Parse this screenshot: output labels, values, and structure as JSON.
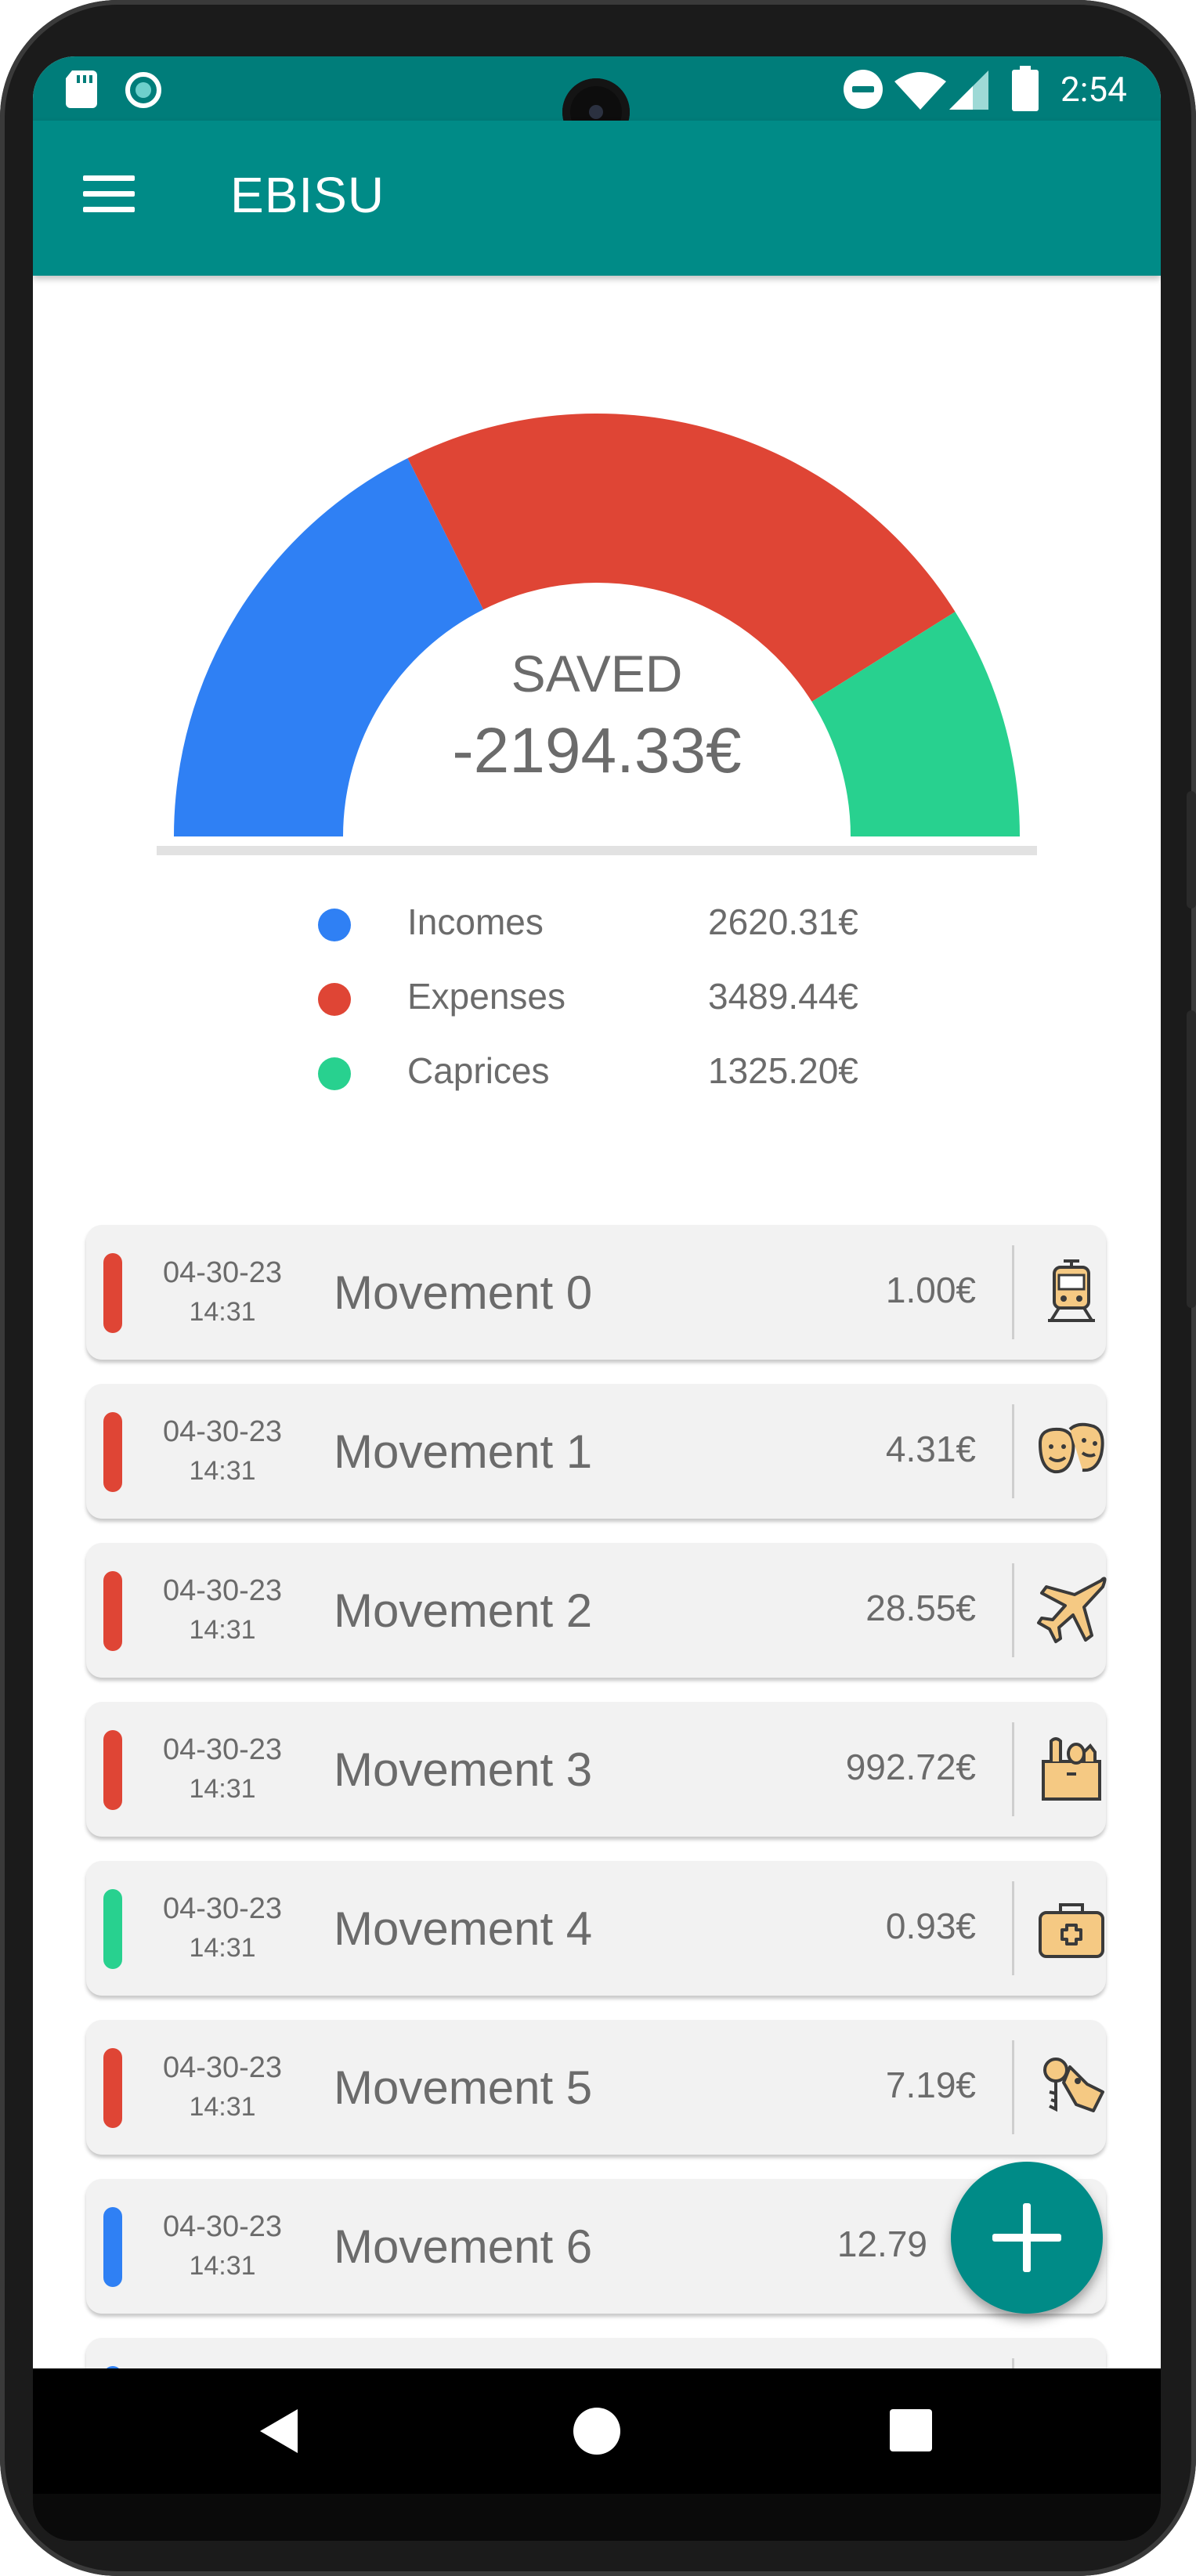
{
  "status_bar": {
    "time": "2:54"
  },
  "app_bar": {
    "title": "EBISU"
  },
  "gauge": {
    "label": "SAVED",
    "value": "-2194.33€"
  },
  "chart_data": {
    "type": "pie",
    "categories": [
      "Incomes",
      "Expenses",
      "Caprices"
    ],
    "values": [
      2620.31,
      3489.44,
      1325.2
    ],
    "colors": [
      "#2f80f4",
      "#df4535",
      "#28d18f"
    ]
  },
  "legend": [
    {
      "name": "Incomes",
      "value": "2620.31€",
      "color": "#2f80f4"
    },
    {
      "name": "Expenses",
      "value": "3489.44€",
      "color": "#df4535"
    },
    {
      "name": "Caprices",
      "value": "1325.20€",
      "color": "#28d18f"
    }
  ],
  "movements": [
    {
      "date": "04-30-23",
      "time": "14:31",
      "name": "Movement 0",
      "amount": "1.00€",
      "type_color": "#df4535",
      "icon": "train-icon"
    },
    {
      "date": "04-30-23",
      "time": "14:31",
      "name": "Movement 1",
      "amount": "4.31€",
      "type_color": "#df4535",
      "icon": "theater-masks-icon"
    },
    {
      "date": "04-30-23",
      "time": "14:31",
      "name": "Movement 2",
      "amount": "28.55€",
      "type_color": "#df4535",
      "icon": "airplane-icon"
    },
    {
      "date": "04-30-23",
      "time": "14:31",
      "name": "Movement 3",
      "amount": "992.72€",
      "type_color": "#df4535",
      "icon": "grocery-bag-icon"
    },
    {
      "date": "04-30-23",
      "time": "14:31",
      "name": "Movement 4",
      "amount": "0.93€",
      "type_color": "#28d18f",
      "icon": "first-aid-kit-icon"
    },
    {
      "date": "04-30-23",
      "time": "14:31",
      "name": "Movement 5",
      "amount": "7.19€",
      "type_color": "#df4535",
      "icon": "keys-tag-icon"
    },
    {
      "date": "04-30-23",
      "time": "14:31",
      "name": "Movement 6",
      "amount": "12.79",
      "type_color": "#2f80f4",
      "icon": ""
    }
  ],
  "theme": {
    "primary": "#008b87",
    "primary_dark": "#007d7a",
    "text": "#6b6b6b"
  }
}
